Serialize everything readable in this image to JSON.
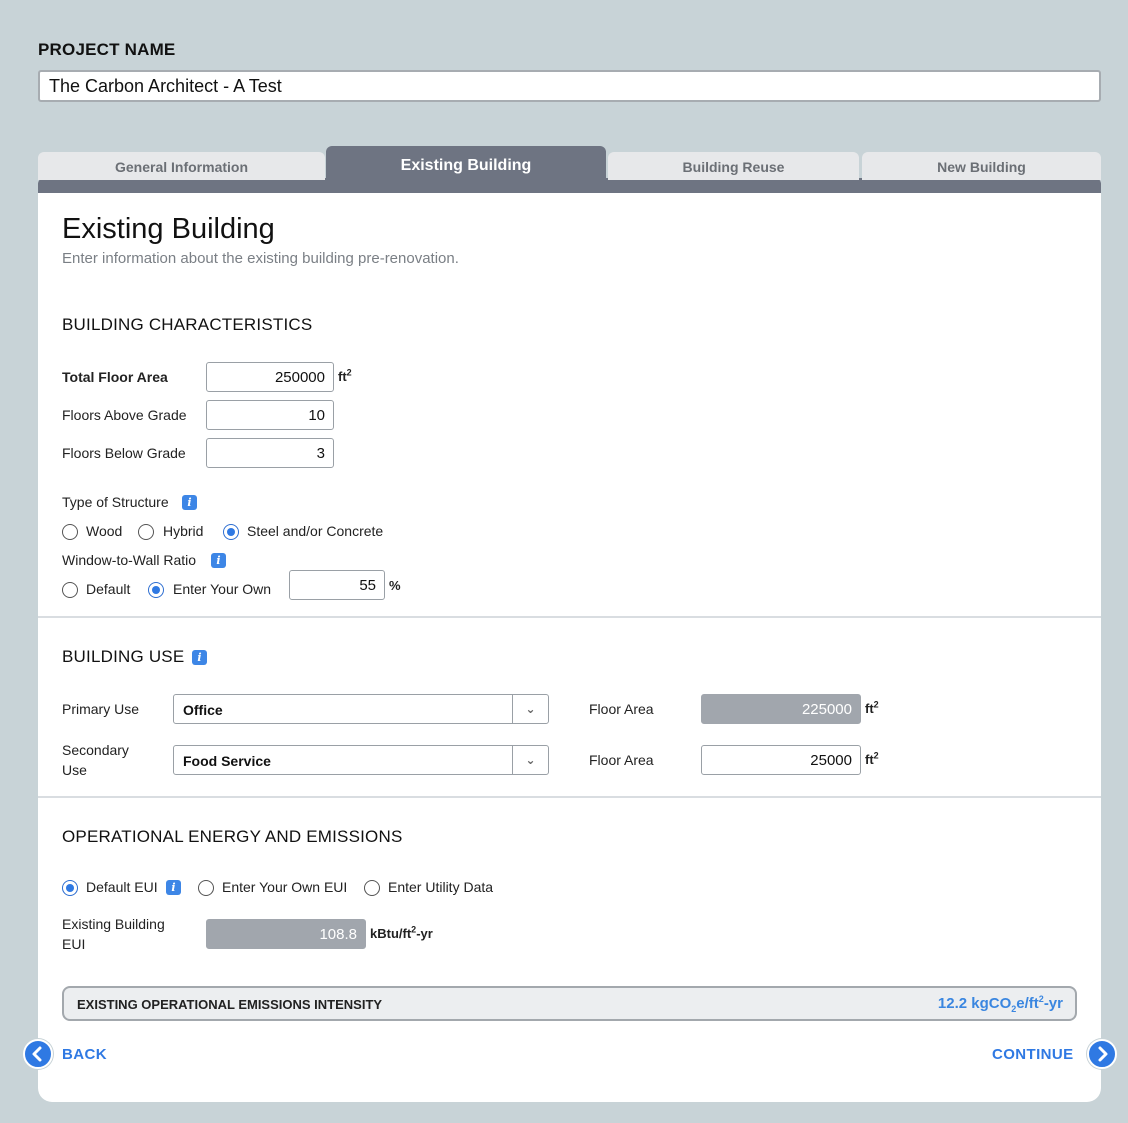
{
  "project": {
    "label": "PROJECT NAME",
    "value": "The Carbon Architect - A Test"
  },
  "tabs": [
    {
      "label": "General Information"
    },
    {
      "label": "Existing Building"
    },
    {
      "label": "Building Reuse"
    },
    {
      "label": "New Building"
    }
  ],
  "page": {
    "title": "Existing Building",
    "subtitle": "Enter information about the existing building pre-renovation."
  },
  "characteristics": {
    "title": "BUILDING CHARACTERISTICS",
    "total_floor_area": {
      "label": "Total Floor Area",
      "value": "250000",
      "unit": "ft"
    },
    "floors_above": {
      "label": "Floors Above Grade",
      "value": "10"
    },
    "floors_below": {
      "label": "Floors Below Grade",
      "value": "3"
    },
    "structure": {
      "label": "Type of Structure",
      "options": [
        "Wood",
        "Hybrid",
        "Steel and/or Concrete"
      ],
      "selected": "Steel and/or Concrete"
    },
    "wwr": {
      "label": "Window-to-Wall Ratio",
      "options": [
        "Default",
        "Enter Your Own"
      ],
      "selected": "Enter Your Own",
      "value": "55",
      "unit": "%"
    }
  },
  "use": {
    "title": "BUILDING USE",
    "primary": {
      "label": "Primary Use",
      "value": "Office",
      "area_label": "Floor Area",
      "area": "225000",
      "unit": "ft"
    },
    "secondary": {
      "label_line1": "Secondary",
      "label_line2": "Use",
      "value": "Food Service",
      "area_label": "Floor Area",
      "area": "25000",
      "unit": "ft"
    }
  },
  "energy": {
    "title": "OPERATIONAL ENERGY AND EMISSIONS",
    "options": [
      "Default EUI",
      "Enter Your Own EUI",
      "Enter Utility Data"
    ],
    "selected": "Default EUI",
    "eui": {
      "label_line1": "Existing Building",
      "label_line2": "EUI",
      "value": "108.8",
      "unit_a": "kBtu/ft",
      "unit_b": "-yr"
    }
  },
  "summary": {
    "label": "EXISTING OPERATIONAL EMISSIONS INTENSITY",
    "value_a": "12.2 kgCO",
    "value_b": "e/ft",
    "value_c": "-yr"
  },
  "nav": {
    "back": "BACK",
    "continue": "CONTINUE"
  },
  "colors": {
    "accent": "#2f79e3",
    "tab_active": "#6e7482",
    "background": "#c8d3d7"
  }
}
